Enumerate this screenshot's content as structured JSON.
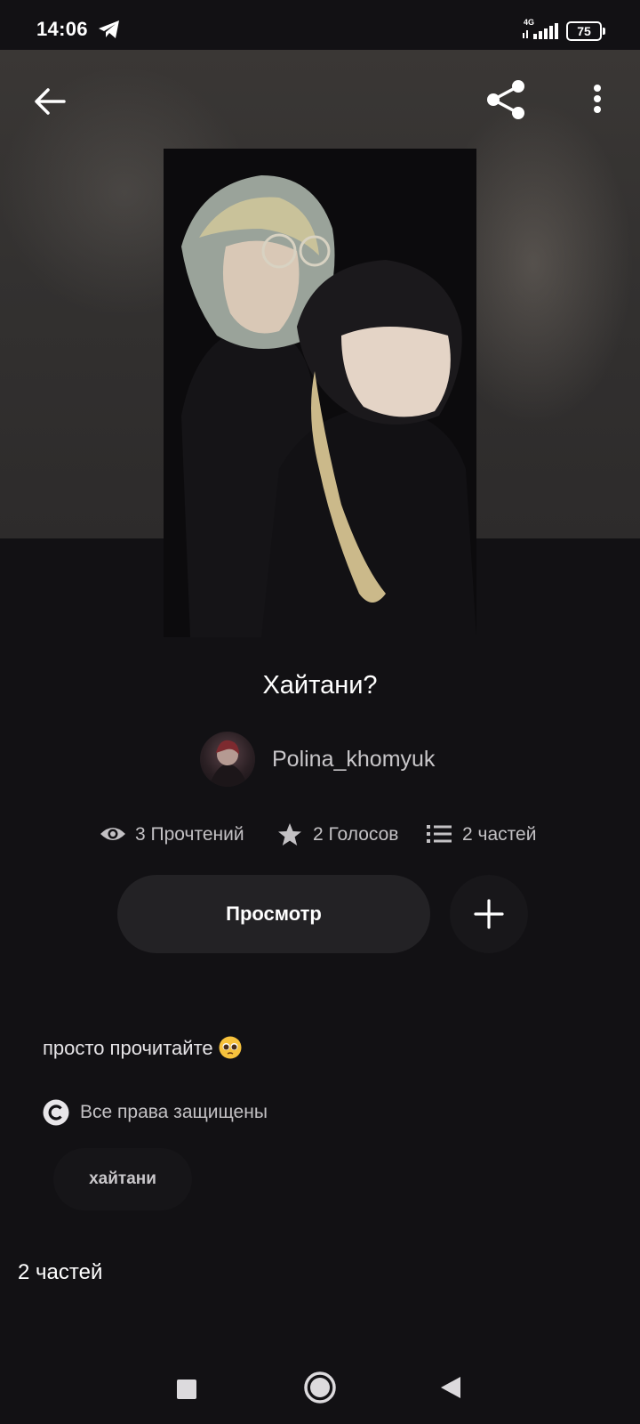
{
  "status_bar": {
    "time": "14:06",
    "network": "4G",
    "battery": "75"
  },
  "header": {
    "back_icon": "arrow-left-icon",
    "share_icon": "share-icon",
    "more_icon": "more-vertical-icon"
  },
  "story": {
    "title": "Хайтани?",
    "author": "Polina_khomyuk",
    "stats": {
      "reads": "3 Прочтений",
      "votes": "2 Голосов",
      "parts": "2 частей"
    },
    "view_button_label": "Просмотр",
    "add_icon": "plus-icon",
    "description": "просто прочитайте",
    "copyright": "Все права защищены",
    "tags": [
      "хайтани"
    ],
    "parts_heading": "2 частей"
  },
  "colors": {
    "background": "#121114",
    "button": "#232225",
    "muted_text": "#c3c1c4"
  }
}
